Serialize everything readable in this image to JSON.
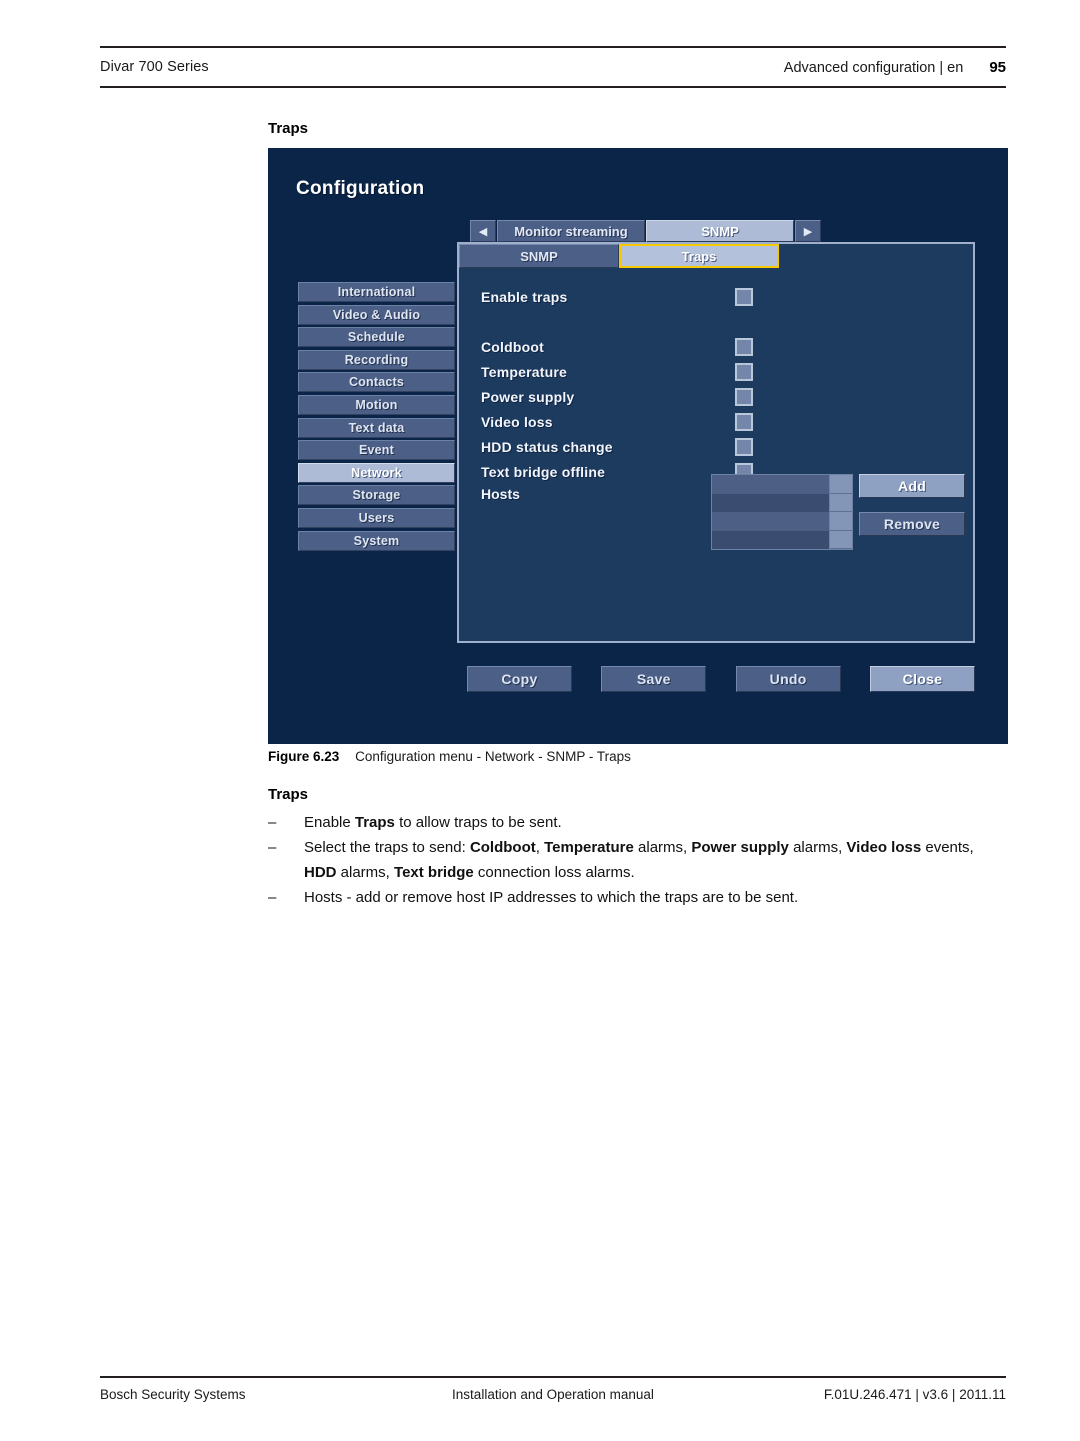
{
  "header": {
    "left": "Divar 700 Series",
    "chapter": "Advanced configuration | en",
    "page_number": "95"
  },
  "headings": {
    "above_figure": "Traps",
    "below_figure": "Traps"
  },
  "screenshot": {
    "title": "Configuration",
    "outer_tabs": {
      "prev_arrow": "◀",
      "next_arrow": "▶",
      "items": [
        {
          "label": "Monitor streaming",
          "selected": false
        },
        {
          "label": "SNMP",
          "selected": true
        }
      ]
    },
    "inner_tabs": [
      {
        "label": "SNMP",
        "selected": false
      },
      {
        "label": "Traps",
        "selected": true
      }
    ],
    "sidebar": {
      "items": [
        {
          "label": "International",
          "active": false
        },
        {
          "label": "Video & Audio",
          "active": false
        },
        {
          "label": "Schedule",
          "active": false
        },
        {
          "label": "Recording",
          "active": false
        },
        {
          "label": "Contacts",
          "active": false
        },
        {
          "label": "Motion",
          "active": false
        },
        {
          "label": "Text data",
          "active": false
        },
        {
          "label": "Event",
          "active": false
        },
        {
          "label": "Network",
          "active": true
        },
        {
          "label": "Storage",
          "active": false
        },
        {
          "label": "Users",
          "active": false
        },
        {
          "label": "System",
          "active": false
        }
      ]
    },
    "settings": {
      "enable_traps": {
        "label": "Enable traps",
        "checked": false
      },
      "trap_types": [
        {
          "label": "Coldboot",
          "checked": false
        },
        {
          "label": "Temperature",
          "checked": false
        },
        {
          "label": "Power supply",
          "checked": false
        },
        {
          "label": "Video loss",
          "checked": false
        },
        {
          "label": "HDD status change",
          "checked": false
        },
        {
          "label": "Text bridge offline",
          "checked": false
        }
      ],
      "hosts": {
        "label": "Hosts",
        "entries": [],
        "add_label": "Add",
        "remove_label": "Remove"
      }
    },
    "action_buttons": [
      {
        "label": "Copy",
        "highlighted": false
      },
      {
        "label": "Save",
        "highlighted": false
      },
      {
        "label": "Undo",
        "highlighted": false
      },
      {
        "label": "Close",
        "highlighted": true
      }
    ],
    "colors": {
      "panel_outer": "#0b2549",
      "panel_inner": "#1d3a5f",
      "button": "#4c6087",
      "button_highlight": "#8fa1c2",
      "tab_selected_border": "#f6c800",
      "tab_selected_fill": "#b4c1da",
      "panel_border": "#9fb0cc"
    }
  },
  "caption": {
    "label": "Figure",
    "number": "6.23",
    "text": "Configuration menu - Network - SNMP - Traps"
  },
  "bullets": [
    {
      "dash": "–",
      "parts": [
        {
          "t": "Enable ",
          "b": false
        },
        {
          "t": "Traps",
          "b": true
        },
        {
          "t": " to allow traps to be sent.",
          "b": false
        }
      ]
    },
    {
      "dash": "–",
      "parts": [
        {
          "t": "Select the traps to send: ",
          "b": false
        },
        {
          "t": "Coldboot",
          "b": true
        },
        {
          "t": ", ",
          "b": false
        },
        {
          "t": "Temperature",
          "b": true
        },
        {
          "t": " alarms, ",
          "b": false
        },
        {
          "t": "Power supply",
          "b": true
        },
        {
          "t": " alarms, ",
          "b": false
        },
        {
          "t": "Video loss",
          "b": true
        },
        {
          "t": " events, ",
          "b": false
        },
        {
          "t": "HDD",
          "b": true
        },
        {
          "t": " alarms, ",
          "b": false
        },
        {
          "t": "Text bridge",
          "b": true
        },
        {
          "t": " connection loss alarms.",
          "b": false
        }
      ]
    },
    {
      "dash": "–",
      "parts": [
        {
          "t": "Hosts - add or remove host IP addresses to which the traps are to be sent.",
          "b": false
        }
      ]
    }
  ],
  "footer": {
    "left": "Bosch Security Systems",
    "middle": "Installation and Operation manual",
    "right": "F.01U.246.471 | v3.6 | 2011.11"
  }
}
